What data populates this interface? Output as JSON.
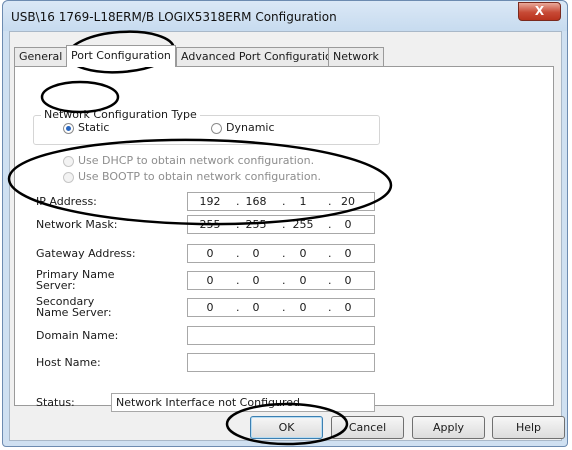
{
  "window": {
    "title": "USB\\16 1769-L18ERM/B LOGIX5318ERM Configuration",
    "close_glyph": "X"
  },
  "tabs": [
    {
      "label": "General"
    },
    {
      "label": "Port Configuration"
    },
    {
      "label": "Advanced Port Configuration"
    },
    {
      "label": "Network"
    }
  ],
  "network_config_type": {
    "legend": "Network Configuration Type",
    "static_label": "Static",
    "dynamic_label": "Dynamic",
    "selected": "Static"
  },
  "options": {
    "dhcp_label": "Use DHCP to obtain network configuration.",
    "bootp_label": "Use BOOTP to obtain network configuration."
  },
  "fields": {
    "ip_label": "IP Address:",
    "ip": [
      "192",
      "168",
      "1",
      "20"
    ],
    "mask_label": "Network Mask:",
    "mask": [
      "255",
      "255",
      "255",
      "0"
    ],
    "gateway_label": "Gateway Address:",
    "gateway": [
      "0",
      "0",
      "0",
      "0"
    ],
    "primary_label": "Primary Name Server:",
    "primary": [
      "0",
      "0",
      "0",
      "0"
    ],
    "secondary_label": "Secondary Name Server:",
    "secondary": [
      "0",
      "0",
      "0",
      "0"
    ],
    "domain_label": "Domain Name:",
    "domain_value": "",
    "host_label": "Host Name:",
    "host_value": "",
    "separator": "."
  },
  "status": {
    "label": "Status:",
    "value": "Network Interface not Configured"
  },
  "buttons": {
    "ok": "OK",
    "cancel": "Cancel",
    "apply": "Apply",
    "help": "Help"
  },
  "annotation_color": "#000000"
}
